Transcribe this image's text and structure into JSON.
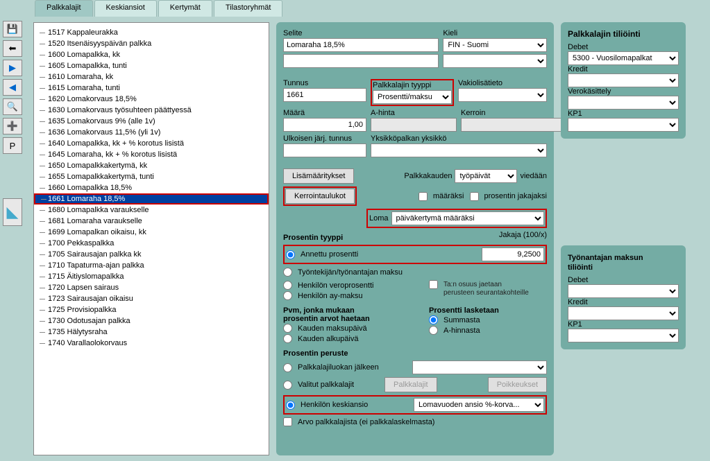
{
  "tabs": [
    "Palkkalajit",
    "Keskiansiot",
    "Kertymät",
    "Tilastoryhmät"
  ],
  "toolbar": {
    "save": "💾",
    "back": "⬅",
    "fwd_blue": "▶",
    "prev_blue": "◀",
    "zoom": "🔍",
    "add": "➕",
    "p": "P",
    "logo": "◣"
  },
  "tree": [
    "1517 Kappaleurakka",
    "1520 Itsenäisyyspäivän palkka",
    "1600 Lomapalkka, kk",
    "1605 Lomapalkka, tunti",
    "1610 Lomaraha, kk",
    "1615 Lomaraha, tunti",
    "1620 Lomakorvaus 18,5%",
    "1630 Lomakorvaus työsuhteen päättyessä",
    "1635 Lomakorvaus 9% (alle 1v)",
    "1636 Lomakorvaus 11,5% (yli 1v)",
    "1640 Lomapalkka, kk + % korotus lisistä",
    "1645 Lomaraha, kk + % korotus lisistä",
    "1650 Lomapalkkakertymä, kk",
    "1655 Lomapalkkakertymä, tunti",
    "1660 Lomapalkka 18,5%",
    "1661 Lomaraha 18,5%",
    "1680 Lomapalkka varaukselle",
    "1681 Lomaraha varaukselle",
    "1699 Lomapalkan oikaisu, kk",
    "1700 Pekkaspalkka",
    "1705 Sairausajan palkka kk",
    "1710 Tapaturma-ajan palkka",
    "1715 Äitiyslomapalkka",
    "1720 Lapsen sairaus",
    "1723 Sairausajan oikaisu",
    "1725 Provisiopalkka",
    "1730 Odotusajan palkka",
    "1735 Hälytysraha",
    "1740 Varallaolokorvaus"
  ],
  "tree_selected_index": 15,
  "form": {
    "selite_lbl": "Selite",
    "selite": "Lomaraha 18,5%",
    "kieli_lbl": "Kieli",
    "kieli": "FIN - Suomi",
    "tunnus_lbl": "Tunnus",
    "tunnus": "1661",
    "plktyyppi_lbl": "Palkkalajin tyyppi",
    "plktyyppi": "Prosentti/maksu",
    "vakio_lbl": "Vakiolisätieto",
    "vakio": "",
    "maara_lbl": "Määrä",
    "maara": "1,00",
    "ahinta_lbl": "A-hinta",
    "ahinta": "",
    "kerroin_lbl": "Kerroin",
    "kerroin": "",
    "ulk_lbl": "Ulkoisen järj. tunnus",
    "ulk": "",
    "yks_lbl": "Yksikköpalkan yksikkö",
    "yks": "",
    "lisam_btn": "Lisämääritykset",
    "kerr_btn": "Kerrointaulukot",
    "palkkakauden": "Palkkakauden",
    "tyopaivat": "työpäivät",
    "viedaan": "viedään",
    "maaraksi": "määräksi",
    "prosjak": "prosentin jakajaksi",
    "loma_lbl": "Loma",
    "loma_sel": "päiväkertymä määräksi",
    "pros_tyyppi_hdr": "Prosentin tyyppi",
    "jakaja_lbl": "Jakaja (100/x)",
    "annettu": "Annettu prosentti",
    "annettu_val": "9,2500",
    "tyonmaksu": "Työntekijän/työnantajan maksu",
    "henkvero": "Henkilön veroprosentti",
    "henkay": "Henkilön ay-maksu",
    "taosuus1": "Ta:n osuus jaetaan",
    "taosuus2": "perusteen seurantakohteille",
    "pvm_hdr1": "Pvm, jonka mukaan",
    "pvm_hdr2": "prosentin arvot haetaan",
    "proslask_hdr": "Prosentti lasketaan",
    "kmaksu": "Kauden maksupäivä",
    "kalku": "Kauden alkupäivä",
    "summasta": "Summasta",
    "ahinnasta": "A-hinnasta",
    "prosperuste_hdr": "Prosentin peruste",
    "plkluokan": "Palkkalajiluokan jälkeen",
    "valitut": "Valitut palkkalajit",
    "plk_btn": "Palkkalajit",
    "poikk_btn": "Poikkeukset",
    "henkkeski": "Henkilön keskiansio",
    "henkkeski_sel": "Lomavuoden ansio %-korva...",
    "arvo": "Arvo palkkalajista (ei palkkalaskelmasta)"
  },
  "right": {
    "t1": "Palkkalajin tiliöinti",
    "debet": "Debet",
    "debet_val": "5300 - Vuosilomapalkat",
    "kredit": "Kredit",
    "verok": "Verokäsittely",
    "kp1": "KP1",
    "t2_1": "Työnantajan maksun",
    "t2_2": "tiliöinti"
  }
}
